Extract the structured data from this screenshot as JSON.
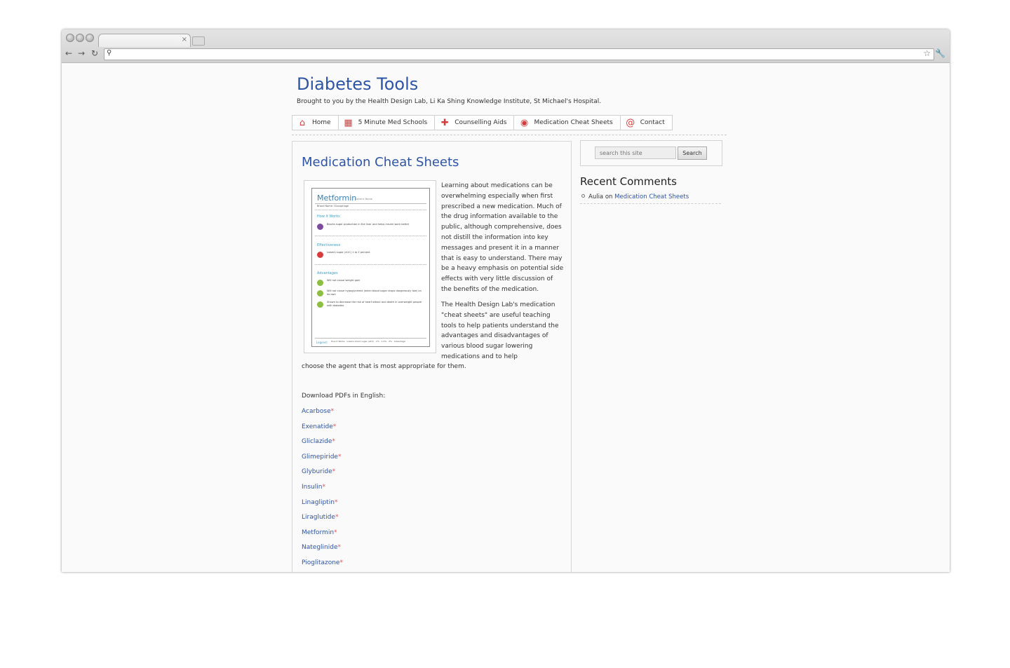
{
  "browser": {
    "tab_close": "×",
    "icons": [
      "back-arrow-icon",
      "forward-arrow-icon",
      "reload-icon",
      "search-icon",
      "star-icon",
      "wrench-icon"
    ]
  },
  "site": {
    "title": "Diabetes Tools",
    "description": "Brought to you by the Health Design Lab, Li Ka Shing Knowledge Institute, St Michael's Hospital."
  },
  "menu": [
    {
      "label": "Home",
      "icon": "house-icon"
    },
    {
      "label": "5 Minute Med Schools",
      "icon": "clipboard-icon"
    },
    {
      "label": "Counselling Aids",
      "icon": "medical-cross-icon"
    },
    {
      "label": "Medication Cheat Sheets",
      "icon": "pill-icon"
    },
    {
      "label": "Contact",
      "icon": "at-sign-icon"
    }
  ],
  "page": {
    "title": "Medication Cheat Sheets",
    "paragraph1": "Learning about medications can be overwhelming especially when first prescribed a new medication. Much of the drug information available to the public, although comprehensive, does not distill the information into key messages and present it in a manner that is easy to understand. There may be a heavy emphasis on potential side effects with very little discussion of the benefits of the medication.",
    "paragraph2a": "The Health Design Lab's medication \"cheat sheets\" are useful teaching tools to help patients understand the advantages and disadvantages of various blood sugar lowering medications and to help",
    "paragraph2b": "choose the agent that is most appropriate for them.",
    "download_label": "Download PDFs in English:",
    "asterisk": "*",
    "drugs": [
      "Acarbose",
      "Exenatide",
      "Gliclazide",
      "Glimepiride",
      "Glyburide",
      "Insulin",
      "Linagliptin",
      "Liraglutide",
      "Metformin",
      "Nateglinide",
      "Pioglitazone"
    ]
  },
  "cheat_sheet_image": {
    "title": "Metformin",
    "generic": "Generic Name",
    "brand": "Brand Name: Glucophage",
    "section1": "How it Works",
    "line1": "Blocks sugar production in the liver and helps insulin work better",
    "section2": "Effectiveness",
    "line2": "Lowers sugar (A1C) 1 to 2 percent",
    "section3": "Advantages",
    "adv1": "Will not cause weight gain",
    "adv2": "Will not cause hypoglycemia (when blood sugar drops dangerously low) on its own",
    "adv3": "Shown to decrease the risk of heart attack and death in overweight people with diabetes",
    "legend": "Legend:",
    "legend_items": "How it Works · Lowers blood sugar (A1C) · 1% · 1-2% · 2% · Advantage"
  },
  "sidebar": {
    "search_placeholder": "search this site",
    "search_button": "Search",
    "recent_comments_title": "Recent Comments",
    "comment_author": "Aulia",
    "comment_on": "on",
    "comment_link": "Medication Cheat Sheets"
  }
}
